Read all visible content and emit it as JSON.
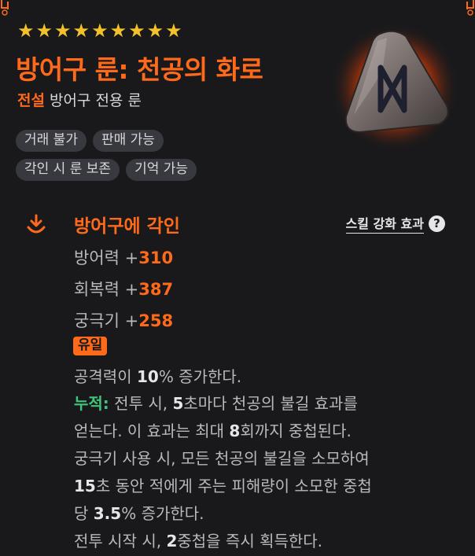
{
  "item": {
    "stars": 9,
    "title": "방어구 룬: 천공의 화로",
    "grade": "전설",
    "type": "방어구 전용 룬",
    "tags": [
      [
        "거래 불가",
        "판매 가능"
      ],
      [
        "각인 시 룬 보존",
        "기억 가능"
      ]
    ]
  },
  "engrave": {
    "title": "방어구에 각인",
    "skill_link": "스킬 강화 효과",
    "help": "?",
    "stats": [
      {
        "label": "방어력 +",
        "value": "310"
      },
      {
        "label": "회복력 +",
        "value": "387"
      },
      {
        "label": "궁극기 +",
        "value": "258"
      }
    ],
    "unique": "유일"
  },
  "effect": {
    "l1": {
      "a": "공격력이 ",
      "b": "10",
      "c": "% 증가한다."
    },
    "l2": {
      "stack": "누적:",
      "a": " 전투 시, ",
      "b": "5",
      "c": "초마다 천공의 불길 효과를"
    },
    "l3": {
      "a": "얻는다. 이 효과는 최대 ",
      "b": "8",
      "c": "회까지 중첩된다."
    },
    "l4": {
      "a": "궁극기 사용 시, 모든 천공의 불길을 소모하여"
    },
    "l5": {
      "b": "15",
      "c": "초 동안 적에게 주는 피해량이 소모한 중첩"
    },
    "l6": {
      "a": "당 ",
      "b": "3.5",
      "c": "% 증가한다."
    },
    "l7": {
      "a": "전투 시작 시, ",
      "b": "2",
      "c": "중첩을 즉시 획득한다."
    }
  },
  "colors": {
    "accent": "#ff6a1a",
    "star": "#f3c22b",
    "stack": "#41c47b",
    "tag_bg": "#38393e",
    "background": "#19191b"
  }
}
